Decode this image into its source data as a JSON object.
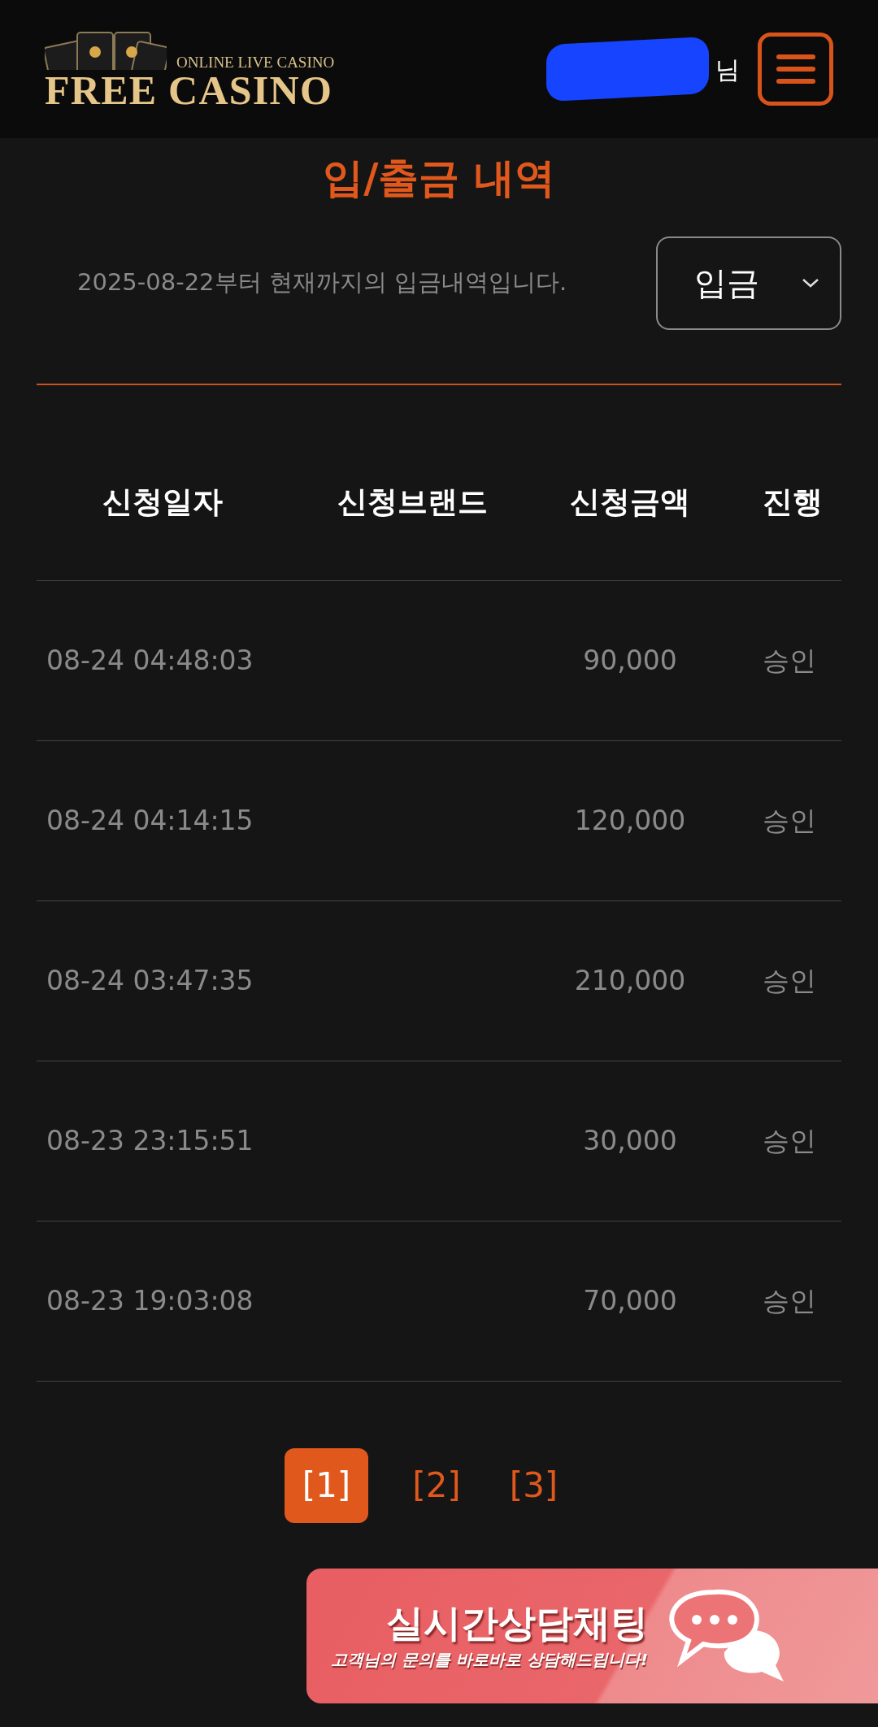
{
  "header": {
    "logo": {
      "tagline": "ONLINE LIVE CASINO",
      "name": "FREE CASINO"
    },
    "user": {
      "redacted": true,
      "suffix": "님"
    }
  },
  "title": "입/출금 내역",
  "info": "2025-08-22부터 현재까지의 입금내역입니다.",
  "filter": {
    "value": "입금"
  },
  "table": {
    "columns": [
      "신청일자",
      "신청브랜드",
      "신청금액",
      "진행"
    ],
    "rows": [
      {
        "date": "08-24 04:48:03",
        "amount": "90,000",
        "status": "승인"
      },
      {
        "date": "08-24 04:14:15",
        "amount": "120,000",
        "status": "승인"
      },
      {
        "date": "08-24 03:47:35",
        "amount": "210,000",
        "status": "승인"
      },
      {
        "date": "08-23 23:15:51",
        "amount": "30,000",
        "status": "승인"
      },
      {
        "date": "08-23 19:03:08",
        "amount": "70,000",
        "status": "승인"
      }
    ]
  },
  "pagination": [
    {
      "label": "[1]",
      "selected": true
    },
    {
      "label": "[2]",
      "selected": false
    },
    {
      "label": "[3]",
      "selected": false
    }
  ],
  "chat_banner": {
    "title": "실시간상담채팅",
    "subtitle": "고객님의 문의를 바로바로 상담해드립니다!"
  }
}
